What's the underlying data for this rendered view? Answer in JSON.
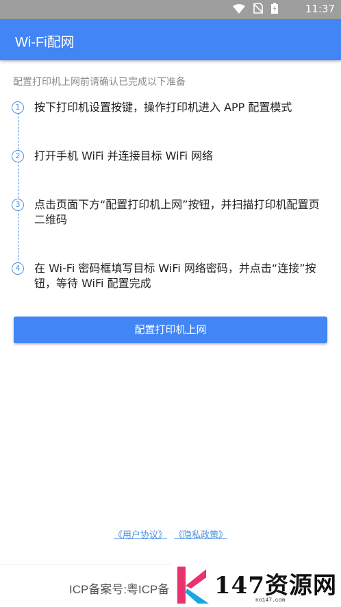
{
  "status_bar": {
    "time": "11:37",
    "icons": [
      "wifi-icon",
      "no-sim-icon",
      "battery-icon"
    ]
  },
  "header": {
    "title": "Wi-Fi配网"
  },
  "intro": "配置打印机上网前请确认已完成以下准备",
  "steps": [
    {
      "number": "1",
      "text": "按下打印机设置按键，操作打印机进入 APP 配置模式"
    },
    {
      "number": "2",
      "text": "打开手机 WiFi 并连接目标 WiFi 网络"
    },
    {
      "number": "3",
      "text": "点击页面下方“配置打印机上网”按钮，并扫描打印机配置页二维码"
    },
    {
      "number": "4",
      "text": "在 Wi-Fi 密码框填写目标 WiFi 网络密码，并点击“连接”按钮，等待 WiFi 配置完成"
    }
  ],
  "primary_button": "配置打印机上网",
  "links": {
    "user_agreement": "《用户协议》",
    "privacy_policy": "《隐私政策》"
  },
  "footer": {
    "icp": "ICP备案号:粤ICP备"
  },
  "watermark": {
    "text": "147资源网",
    "domain": "no147.com"
  },
  "colors": {
    "accent": "#4285f4",
    "status_bar": "#9e9e9e",
    "link": "#4a90e2"
  }
}
